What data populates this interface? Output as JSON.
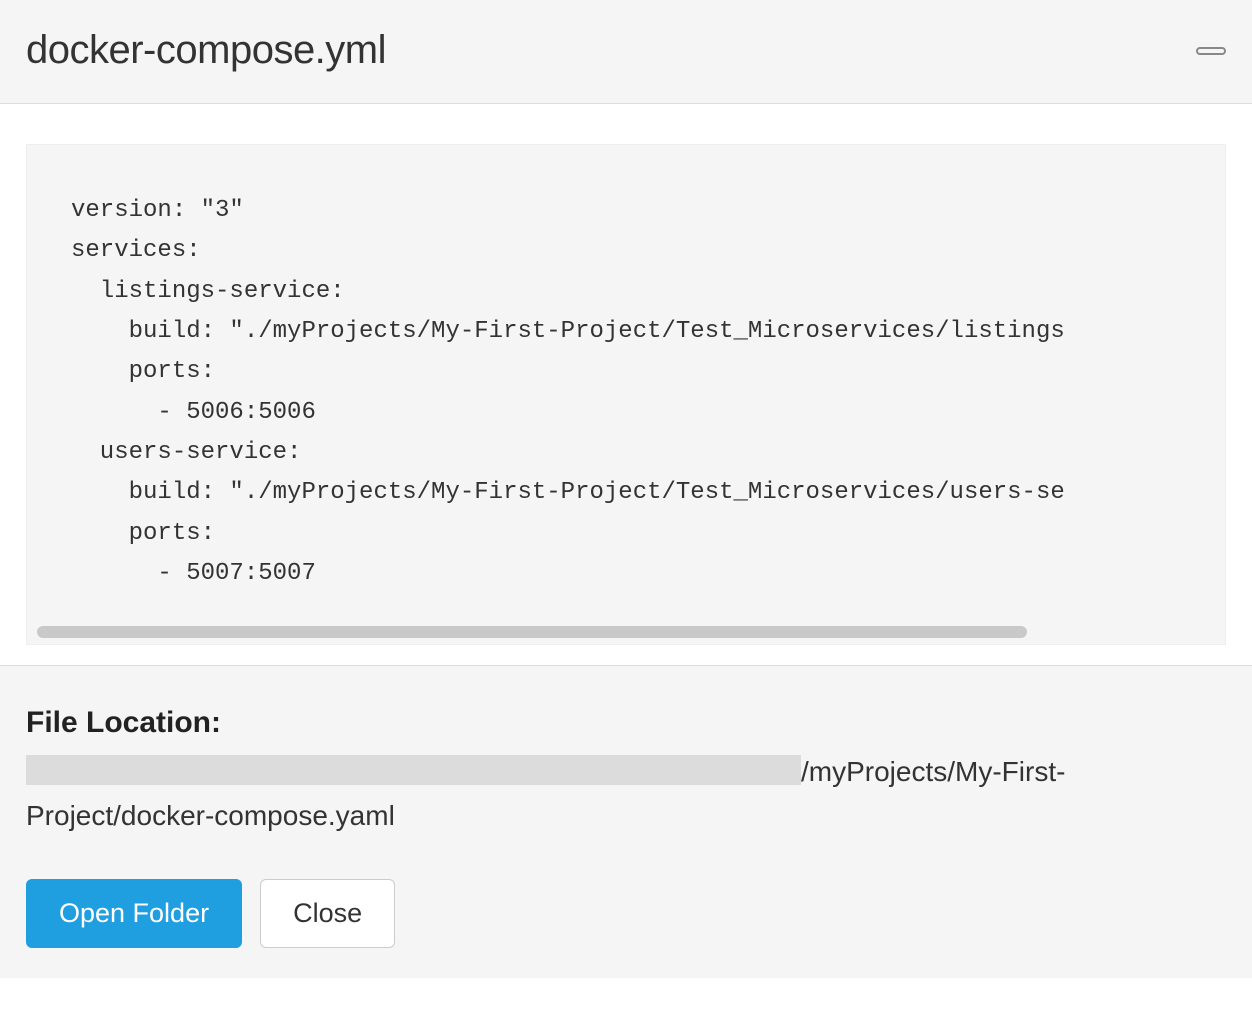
{
  "header": {
    "title": "docker-compose.yml"
  },
  "code": "version: \"3\"\nservices:\n  listings-service:\n    build: \"./myProjects/My-First-Project/Test_Microservices/listings\n    ports:\n      - 5006:5006\n  users-service:\n    build: \"./myProjects/My-First-Project/Test_Microservices/users-se\n    ports:\n      - 5007:5007",
  "footer": {
    "file_location_label": "File Location:",
    "file_location_path_suffix": "/myProjects/My-First-Project/docker-compose.yaml",
    "open_folder_label": "Open Folder",
    "close_label": "Close"
  }
}
